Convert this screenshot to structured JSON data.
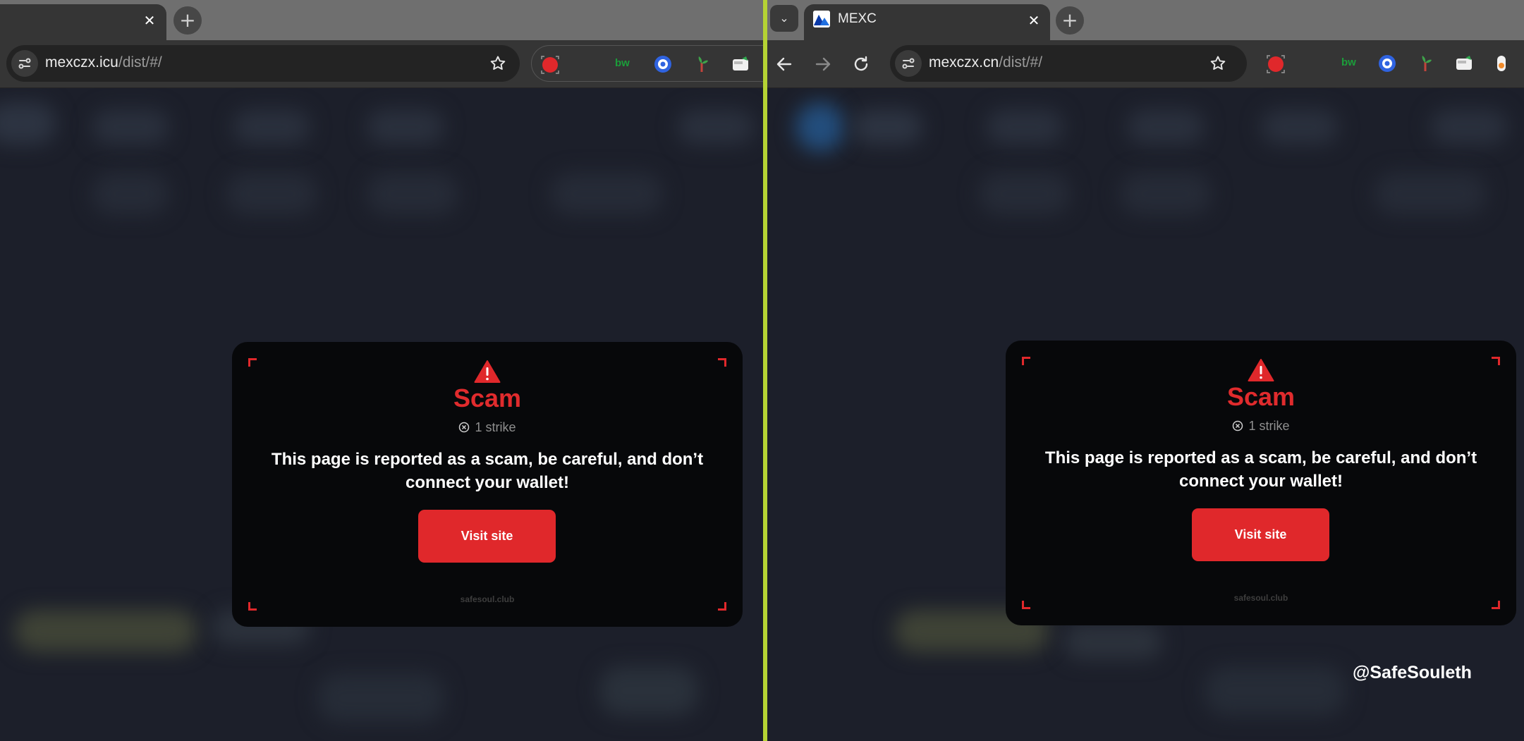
{
  "left_window": {
    "tab": {
      "close_glyph": "✕"
    },
    "new_tab_glyph": "+",
    "address": {
      "host": "mexczx.icu",
      "path": "/dist/#/"
    },
    "icons": [
      "site-info-icon",
      "bookmark-star-icon",
      "record-extension-icon",
      "bw-extension-icon",
      "target-extension-icon",
      "plant-extension-icon",
      "wallet-extension-icon"
    ],
    "extension_labels": {
      "bw": "bw"
    }
  },
  "right_window": {
    "tab": {
      "title": "MEXC",
      "close_glyph": "✕"
    },
    "new_tab_glyph": "+",
    "tab_search_glyph": "⌄",
    "address": {
      "host": "mexczx.cn",
      "path": "/dist/#/"
    },
    "icons": [
      "back-arrow-icon",
      "forward-arrow-icon",
      "reload-icon",
      "site-info-icon",
      "bookmark-star-icon",
      "record-extension-icon",
      "bw-extension-icon",
      "target-extension-icon",
      "plant-extension-icon",
      "wallet-extension-icon",
      "toggle-extension-icon",
      "puzzle-extensions-icon"
    ],
    "extension_labels": {
      "bw": "bw"
    }
  },
  "warning_card": {
    "title": "Scam",
    "strike_text": "1 strike",
    "message": "This page is reported as a scam, be careful, and don’t connect your wallet!",
    "button_label": "Visit site",
    "brand": "safesoul.club",
    "colors": {
      "accent": "#e0282b",
      "card_bg": "#07080a",
      "muted": "#8f8f8f"
    }
  },
  "watermark": "@SafeSouleth",
  "colors": {
    "divider": "#b5d334",
    "chrome_tabstrip": "#6f6f6f",
    "chrome_toolbar": "#353535",
    "page_bg": "#1c1f2a"
  }
}
